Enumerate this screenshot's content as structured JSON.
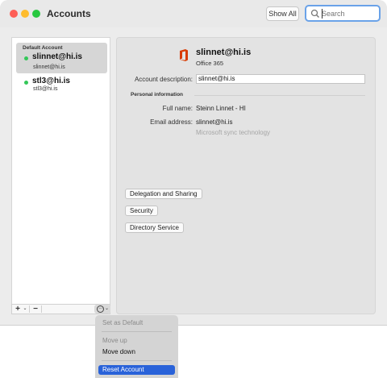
{
  "window": {
    "title": "Accounts"
  },
  "toolbar": {
    "show_all_label": "Show All",
    "search_placeholder": "Search"
  },
  "sidebar": {
    "group_label": "Default Account",
    "accounts": [
      {
        "name": "slinnet@hi.is",
        "email": "slinnet@hi.is",
        "status": "online",
        "selected": true
      },
      {
        "name": "stl3@hi.is",
        "email": "stl3@hi.is",
        "status": "online",
        "selected": false
      }
    ],
    "add_label": "+",
    "add_menu_chevron": "⌄",
    "remove_label": "−",
    "action_icon": "···",
    "action_chevron": "⌄"
  },
  "detail": {
    "header_name": "slinnet@hi.is",
    "header_type": "Office 365",
    "description_label": "Account description:",
    "description_value": "slinnet@hi.is",
    "section_title": "Personal information",
    "full_name_label": "Full name:",
    "full_name_value": "Steinn Linnet - HI",
    "email_label": "Email address:",
    "email_value": "slinnet@hi.is",
    "sync_hint": "Microsoft sync technology",
    "buttons": {
      "delegation": "Delegation and Sharing",
      "security": "Security",
      "directory": "Directory Service"
    }
  },
  "context_menu": {
    "items": [
      {
        "label": "Set as Default",
        "enabled": false
      },
      {
        "label": "Move up",
        "enabled": false
      },
      {
        "label": "Move down",
        "enabled": true
      },
      {
        "label": "Reset Account",
        "enabled": true,
        "highlighted": true
      }
    ]
  },
  "colors": {
    "accent": "#2962d9",
    "status_online": "#34c759",
    "office_logo": "#d83b01"
  }
}
